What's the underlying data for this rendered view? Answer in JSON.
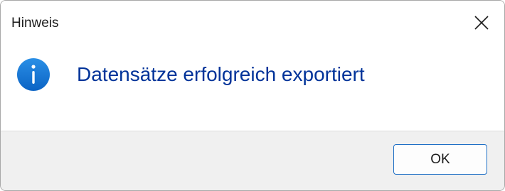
{
  "dialog": {
    "title": "Hinweis",
    "message": "Datensätze erfolgreich exportiert",
    "icon": "info-icon",
    "close_icon": "close-icon",
    "ok_label": "OK"
  },
  "colors": {
    "message_text": "#003399",
    "icon_fill": "#0f6cbd",
    "footer_background": "#f0f0f0",
    "button_border": "#1f6fc5"
  }
}
